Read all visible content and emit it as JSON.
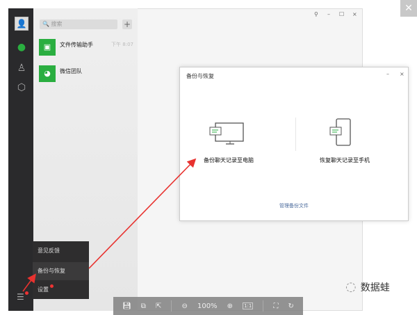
{
  "window_controls": {
    "pin": "⚲",
    "minimize": "–",
    "maximize": "☐",
    "close": "×"
  },
  "outer_close": "✕",
  "search": {
    "placeholder": "搜索"
  },
  "add_label": "+",
  "chats": [
    {
      "name": "文件传输助手",
      "time": "下午 8:07",
      "icon": "folder-transfer-icon"
    },
    {
      "name": "微信团队",
      "time": "",
      "icon": "wechat-icon"
    }
  ],
  "dialog": {
    "title": "备份与恢复",
    "minimize": "–",
    "close": "×",
    "option_pc": "备份聊天记录至电脑",
    "option_phone": "恢复聊天记录至手机",
    "manage": "管理备份文件"
  },
  "menu": {
    "items": [
      "意见反馈",
      "备份与恢复",
      "设置"
    ]
  },
  "toolbar": {
    "zoom": "100%",
    "one_to_one": "1:1"
  },
  "watermark": "数据蛙",
  "colors": {
    "accent": "#2aae40",
    "arrow": "#e8322f"
  }
}
